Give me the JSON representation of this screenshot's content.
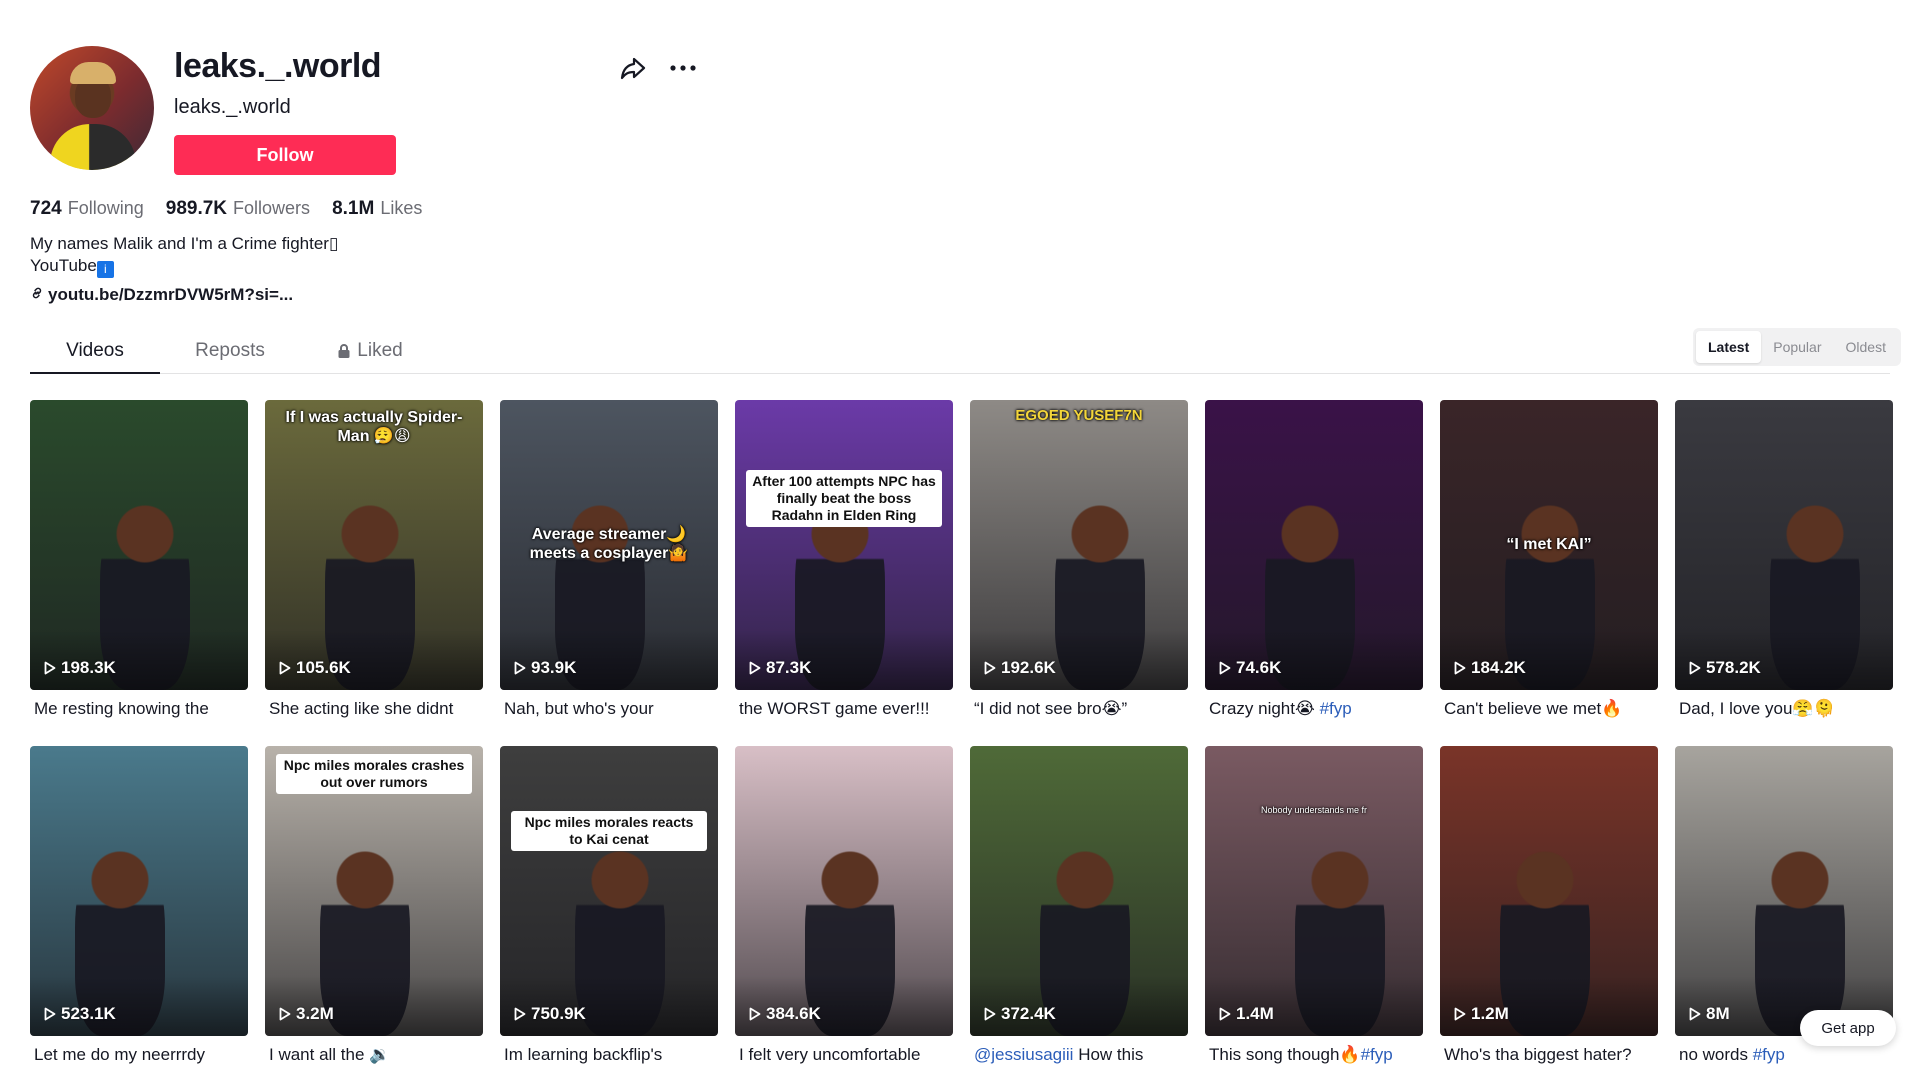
{
  "profile": {
    "username": "leaks._.world",
    "nickname": "leaks._.world",
    "follow_label": "Follow",
    "stats": [
      {
        "value": "724",
        "label": "Following"
      },
      {
        "value": "989.7K",
        "label": "Followers"
      },
      {
        "value": "8.1M",
        "label": "Likes"
      }
    ],
    "bio_line1": "My names Malik and I'm a Crime fighter▯",
    "bio_line2": "YouTube",
    "bio_badge": "i",
    "link": "youtu.be/DzzmrDVW5rM?si=..."
  },
  "tabs": [
    {
      "label": "Videos",
      "active": true
    },
    {
      "label": "Reposts",
      "active": false
    },
    {
      "label": "Liked",
      "active": false
    }
  ],
  "sort": [
    {
      "label": "Latest",
      "active": true
    },
    {
      "label": "Popular",
      "active": false
    },
    {
      "label": "Oldest",
      "active": false
    }
  ],
  "videos": [
    {
      "views": "198.3K",
      "desc": "Me resting knowing the",
      "tag": "",
      "overlay": "",
      "bg": "#2a4a2c"
    },
    {
      "views": "105.6K",
      "desc": "She acting like she didnt",
      "tag": "",
      "overlay": "If I was actually Spider-Man 😮‍💨😩",
      "bg": "#6b6a3c"
    },
    {
      "views": "93.9K",
      "desc": "Nah, but who's your",
      "tag": "",
      "overlay": "Average streamer🌙 meets a cosplayer🤷",
      "bg": "#4d5560"
    },
    {
      "views": "87.3K",
      "desc": "the WORST game ever!!!",
      "tag": "",
      "overlay": "After 100 attempts NPC has finally beat the boss Radahn in Elden Ring",
      "bg": "#6b3aa8"
    },
    {
      "views": "192.6K",
      "desc": "“I did not see bro😭”",
      "tag": "",
      "overlay": "EGOED YUSEF7N",
      "bg": "#8e8a86"
    },
    {
      "views": "74.6K",
      "desc": "Crazy night😭 ",
      "tag": "#fyp",
      "overlay": "",
      "bg": "#3a1248"
    },
    {
      "views": "184.2K",
      "desc": "Can't believe we met🔥",
      "tag": "",
      "overlay": "“I met KAI”",
      "bg": "#3a2528"
    },
    {
      "views": "578.2K",
      "desc": "Dad, I love you😤🫠",
      "tag": "",
      "overlay": "",
      "bg": "#3a3a40"
    },
    {
      "views": "523.1K",
      "desc": "Let me do my neerrrdy",
      "tag": "",
      "overlay": "",
      "bg": "#4a7a8c"
    },
    {
      "views": "3.2M",
      "desc": "I want all the 🔉",
      "tag": "",
      "overlay": "Npc miles morales crashes out over rumors",
      "bg": "#b8b2aa"
    },
    {
      "views": "750.9K",
      "desc": "Im learning backflip's",
      "tag": "",
      "overlay": "Npc miles morales reacts to Kai cenat",
      "bg": "#3e3e3e"
    },
    {
      "views": "384.6K",
      "desc": "I felt very uncomfortable",
      "tag": "",
      "overlay": "",
      "bg": "#d8bfc6"
    },
    {
      "views": "372.4K",
      "desc": " How this",
      "tag": "@jessiusagiii",
      "tag_first": true,
      "overlay": "",
      "bg": "#4f6a38"
    },
    {
      "views": "1.4M",
      "desc": "This song though🔥",
      "tag": "#fyp",
      "overlay": "Nobody understands me fr",
      "bg": "#7a5a62"
    },
    {
      "views": "1.2M",
      "desc": "Who's tha biggest hater?",
      "tag": "",
      "overlay": "",
      "bg": "#7a3428"
    },
    {
      "views": "8M",
      "desc": "no words ",
      "tag": "#fyp",
      "overlay": "",
      "bg": "#a7a49e"
    }
  ],
  "get_app_label": "Get app"
}
